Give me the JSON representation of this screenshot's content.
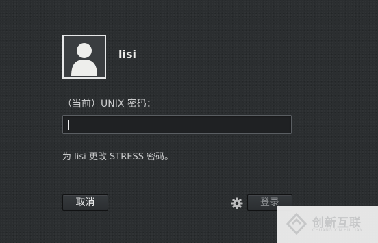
{
  "user": {
    "name": "lisi",
    "avatar_icon": "user-avatar-icon"
  },
  "prompt": {
    "label": "（当前）UNIX 密码："
  },
  "password_field": {
    "value": ""
  },
  "info": {
    "text": "为 lisi 更改 STRESS 密码。"
  },
  "buttons": {
    "cancel_label": "取消",
    "login_label": "登录",
    "settings_icon": "gear-icon"
  },
  "watermark": {
    "title": "创新互联",
    "subtitle": "CHUANG XIN HU LIAN"
  },
  "colors": {
    "background": "#2b2e30",
    "text": "#d9dadb",
    "field_bg": "#1f2123"
  }
}
